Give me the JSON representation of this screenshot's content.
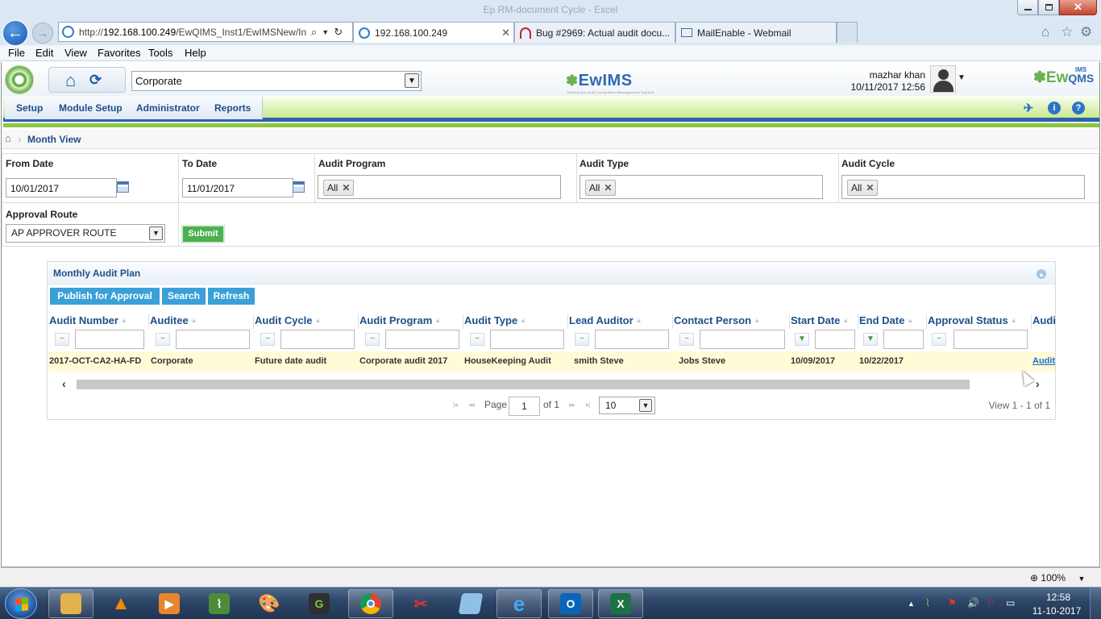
{
  "window": {
    "title": "Ep RM-document Cycle - Excel"
  },
  "browser": {
    "url_prefix": "http://",
    "url_host": "192.168.100.249",
    "url_path": "/EwQIMS_Inst1/EwIMSNew/Ind",
    "tabs": [
      {
        "label": "192.168.100.249",
        "active": true
      },
      {
        "label": "Bug #2969: Actual audit docu...",
        "active": false
      },
      {
        "label": "MailEnable - Webmail",
        "active": false
      }
    ],
    "menu": [
      "File",
      "Edit",
      "View",
      "Favorites",
      "Tools",
      "Help"
    ]
  },
  "app": {
    "organization": "Corporate",
    "center_logo": "EwIMS",
    "center_logo_tagline": "Enterprise-wide Integrated Management System",
    "right_logo_main": "Ew",
    "right_logo_sub": "QMS",
    "right_logo_ims": "IMS",
    "user": {
      "name": "mazhar khan",
      "datetime": "10/11/2017 12:56"
    },
    "main_menu": [
      "Setup",
      "Module Setup",
      "Administrator",
      "Reports"
    ],
    "breadcrumb": "Month View"
  },
  "filters": {
    "from_date_label": "From Date",
    "from_date_value": "10/01/2017",
    "to_date_label": "To Date",
    "to_date_value": "11/01/2017",
    "audit_program_label": "Audit Program",
    "audit_program_chip": "All",
    "audit_type_label": "Audit Type",
    "audit_type_chip": "All",
    "audit_cycle_label": "Audit Cycle",
    "audit_cycle_chip": "All",
    "approval_route_label": "Approval Route",
    "approval_route_value": "AP APPROVER ROUTE",
    "submit_label": "Submit"
  },
  "grid": {
    "title": "Monthly Audit Plan",
    "buttons": [
      "Publish for Approval",
      "Search",
      "Refresh"
    ],
    "columns": [
      "Audit Number",
      "Auditee",
      "Audit Cycle",
      "Audit Program",
      "Audit Type",
      "Lead Auditor",
      "Contact Person",
      "Start Date",
      "End Date",
      "Approval Status",
      "Audi"
    ],
    "row": {
      "audit_number": "2017-OCT-CA2-HA-FD",
      "auditee": "Corporate",
      "audit_cycle": "Future date audit",
      "audit_program": "Corporate audit 2017",
      "audit_type": "HouseKeeping Audit",
      "lead_auditor": "smith Steve",
      "contact_person": "Jobs Steve",
      "start_date": "10/09/2017",
      "end_date": "10/22/2017",
      "approval_status": "",
      "audit_link": "Audit"
    },
    "pager": {
      "page_label": "Page",
      "page_value": "1",
      "of_label": "of 1",
      "rows_value": "10",
      "view_text": "View 1 - 1 of 1"
    }
  },
  "statusbar": {
    "zoom": "100%"
  },
  "taskbar": {
    "time": "12:58",
    "date": "11-10-2017"
  },
  "colors": {
    "menu_green": "#8cc63f",
    "menu_blue": "#2b62b0",
    "button_blue": "#3aa0d8",
    "submit_green": "#4caf50",
    "row_highlight": "#fffbd6"
  }
}
